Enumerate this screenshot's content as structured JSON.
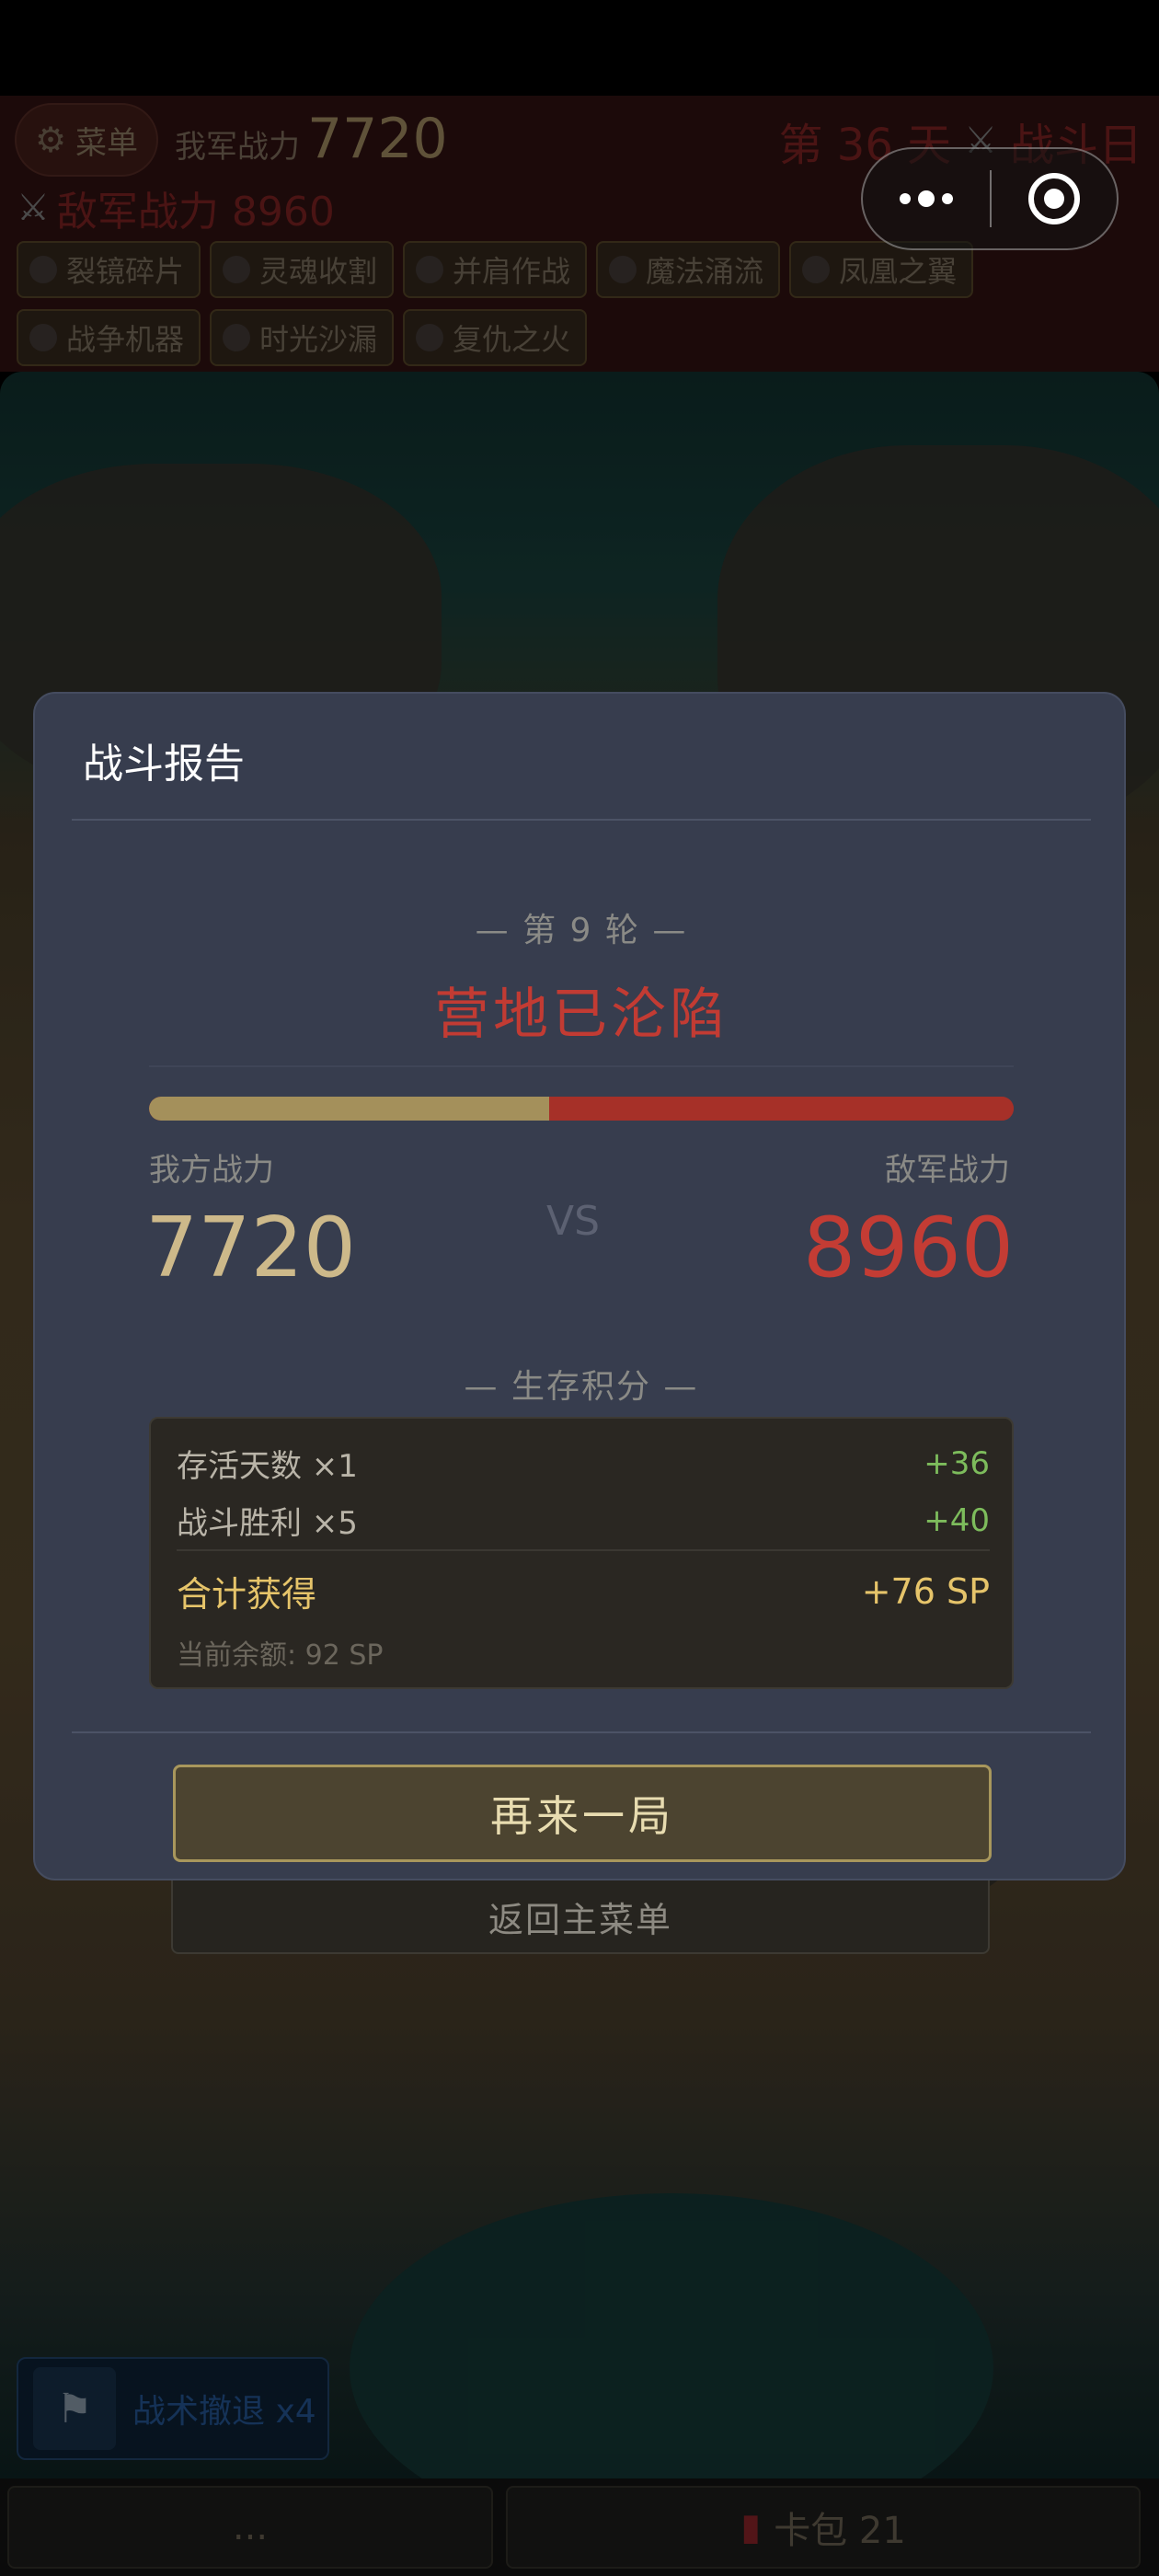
{
  "hud": {
    "menu_label": "菜单",
    "our_power_label": "我军战力",
    "our_power_value": "7720",
    "day_label": "第 36 天",
    "phase_label": "战斗日",
    "enemy_power_label": "敌军战力 8960",
    "buffs": [
      "裂镜碎片",
      "灵魂收割",
      "并肩作战",
      "魔法涌流",
      "凤凰之翼",
      "战争机器",
      "时光沙漏",
      "复仇之火"
    ]
  },
  "modal": {
    "title": "战斗报告",
    "round": "— 第 9 轮 —",
    "result": "营地已沦陷",
    "power_bar": {
      "ours_fraction": 0.463,
      "colors": {
        "ours": "#a4905b",
        "enemy": "#a63028"
      }
    },
    "our_label": "我方战力",
    "enemy_label": "敌军战力",
    "our_value": "7720",
    "enemy_value": "8960",
    "vs": "VS",
    "score_header": "— 生存积分 —",
    "score": {
      "days_label": "存活天数 ×1",
      "days_value": "+36",
      "wins_label": "战斗胜利 ×5",
      "wins_value": "+40",
      "total_label": "合计获得",
      "total_value": "+76 SP",
      "balance": "当前余额: 92 SP"
    },
    "again_button": "再来一局",
    "home_button": "返回主菜单"
  },
  "footer": {
    "retreat_label": "战术撤退 x4",
    "left_button": "...",
    "bag_label": "卡包 21"
  },
  "icons": {
    "menu": "gear-icon",
    "swords": "crossed-swords-icon",
    "retreat": "flag-icon",
    "bag": "card-pack-icon",
    "capsule_more": "more-dots-icon",
    "capsule_close": "target-close-icon"
  }
}
